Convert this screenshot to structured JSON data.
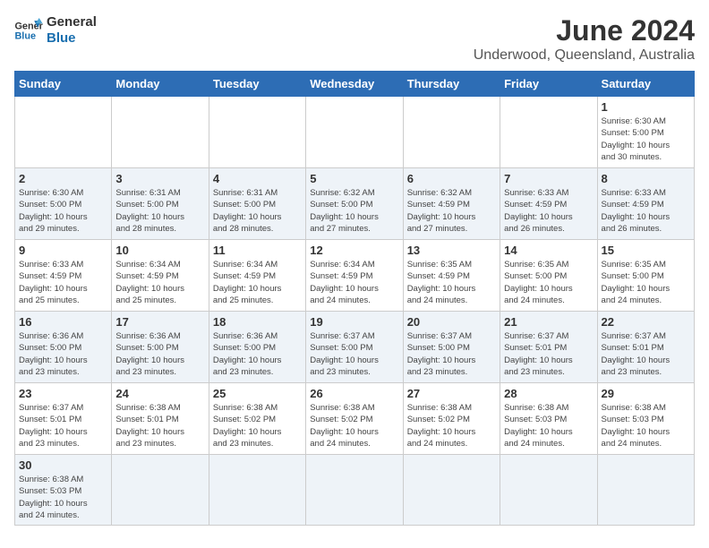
{
  "logo": {
    "line1": "General",
    "line2": "Blue"
  },
  "title": "June 2024",
  "subtitle": "Underwood, Queensland, Australia",
  "headers": [
    "Sunday",
    "Monday",
    "Tuesday",
    "Wednesday",
    "Thursday",
    "Friday",
    "Saturday"
  ],
  "weeks": [
    [
      {
        "day": "",
        "info": ""
      },
      {
        "day": "",
        "info": ""
      },
      {
        "day": "",
        "info": ""
      },
      {
        "day": "",
        "info": ""
      },
      {
        "day": "",
        "info": ""
      },
      {
        "day": "",
        "info": ""
      },
      {
        "day": "1",
        "info": "Sunrise: 6:30 AM\nSunset: 5:00 PM\nDaylight: 10 hours\nand 30 minutes."
      }
    ],
    [
      {
        "day": "2",
        "info": "Sunrise: 6:30 AM\nSunset: 5:00 PM\nDaylight: 10 hours\nand 29 minutes."
      },
      {
        "day": "3",
        "info": "Sunrise: 6:31 AM\nSunset: 5:00 PM\nDaylight: 10 hours\nand 28 minutes."
      },
      {
        "day": "4",
        "info": "Sunrise: 6:31 AM\nSunset: 5:00 PM\nDaylight: 10 hours\nand 28 minutes."
      },
      {
        "day": "5",
        "info": "Sunrise: 6:32 AM\nSunset: 5:00 PM\nDaylight: 10 hours\nand 27 minutes."
      },
      {
        "day": "6",
        "info": "Sunrise: 6:32 AM\nSunset: 4:59 PM\nDaylight: 10 hours\nand 27 minutes."
      },
      {
        "day": "7",
        "info": "Sunrise: 6:33 AM\nSunset: 4:59 PM\nDaylight: 10 hours\nand 26 minutes."
      },
      {
        "day": "8",
        "info": "Sunrise: 6:33 AM\nSunset: 4:59 PM\nDaylight: 10 hours\nand 26 minutes."
      }
    ],
    [
      {
        "day": "9",
        "info": "Sunrise: 6:33 AM\nSunset: 4:59 PM\nDaylight: 10 hours\nand 25 minutes."
      },
      {
        "day": "10",
        "info": "Sunrise: 6:34 AM\nSunset: 4:59 PM\nDaylight: 10 hours\nand 25 minutes."
      },
      {
        "day": "11",
        "info": "Sunrise: 6:34 AM\nSunset: 4:59 PM\nDaylight: 10 hours\nand 25 minutes."
      },
      {
        "day": "12",
        "info": "Sunrise: 6:34 AM\nSunset: 4:59 PM\nDaylight: 10 hours\nand 24 minutes."
      },
      {
        "day": "13",
        "info": "Sunrise: 6:35 AM\nSunset: 4:59 PM\nDaylight: 10 hours\nand 24 minutes."
      },
      {
        "day": "14",
        "info": "Sunrise: 6:35 AM\nSunset: 5:00 PM\nDaylight: 10 hours\nand 24 minutes."
      },
      {
        "day": "15",
        "info": "Sunrise: 6:35 AM\nSunset: 5:00 PM\nDaylight: 10 hours\nand 24 minutes."
      }
    ],
    [
      {
        "day": "16",
        "info": "Sunrise: 6:36 AM\nSunset: 5:00 PM\nDaylight: 10 hours\nand 23 minutes."
      },
      {
        "day": "17",
        "info": "Sunrise: 6:36 AM\nSunset: 5:00 PM\nDaylight: 10 hours\nand 23 minutes."
      },
      {
        "day": "18",
        "info": "Sunrise: 6:36 AM\nSunset: 5:00 PM\nDaylight: 10 hours\nand 23 minutes."
      },
      {
        "day": "19",
        "info": "Sunrise: 6:37 AM\nSunset: 5:00 PM\nDaylight: 10 hours\nand 23 minutes."
      },
      {
        "day": "20",
        "info": "Sunrise: 6:37 AM\nSunset: 5:00 PM\nDaylight: 10 hours\nand 23 minutes."
      },
      {
        "day": "21",
        "info": "Sunrise: 6:37 AM\nSunset: 5:01 PM\nDaylight: 10 hours\nand 23 minutes."
      },
      {
        "day": "22",
        "info": "Sunrise: 6:37 AM\nSunset: 5:01 PM\nDaylight: 10 hours\nand 23 minutes."
      }
    ],
    [
      {
        "day": "23",
        "info": "Sunrise: 6:37 AM\nSunset: 5:01 PM\nDaylight: 10 hours\nand 23 minutes."
      },
      {
        "day": "24",
        "info": "Sunrise: 6:38 AM\nSunset: 5:01 PM\nDaylight: 10 hours\nand 23 minutes."
      },
      {
        "day": "25",
        "info": "Sunrise: 6:38 AM\nSunset: 5:02 PM\nDaylight: 10 hours\nand 23 minutes."
      },
      {
        "day": "26",
        "info": "Sunrise: 6:38 AM\nSunset: 5:02 PM\nDaylight: 10 hours\nand 24 minutes."
      },
      {
        "day": "27",
        "info": "Sunrise: 6:38 AM\nSunset: 5:02 PM\nDaylight: 10 hours\nand 24 minutes."
      },
      {
        "day": "28",
        "info": "Sunrise: 6:38 AM\nSunset: 5:03 PM\nDaylight: 10 hours\nand 24 minutes."
      },
      {
        "day": "29",
        "info": "Sunrise: 6:38 AM\nSunset: 5:03 PM\nDaylight: 10 hours\nand 24 minutes."
      }
    ],
    [
      {
        "day": "30",
        "info": "Sunrise: 6:38 AM\nSunset: 5:03 PM\nDaylight: 10 hours\nand 24 minutes."
      },
      {
        "day": "",
        "info": ""
      },
      {
        "day": "",
        "info": ""
      },
      {
        "day": "",
        "info": ""
      },
      {
        "day": "",
        "info": ""
      },
      {
        "day": "",
        "info": ""
      },
      {
        "day": "",
        "info": ""
      }
    ]
  ]
}
